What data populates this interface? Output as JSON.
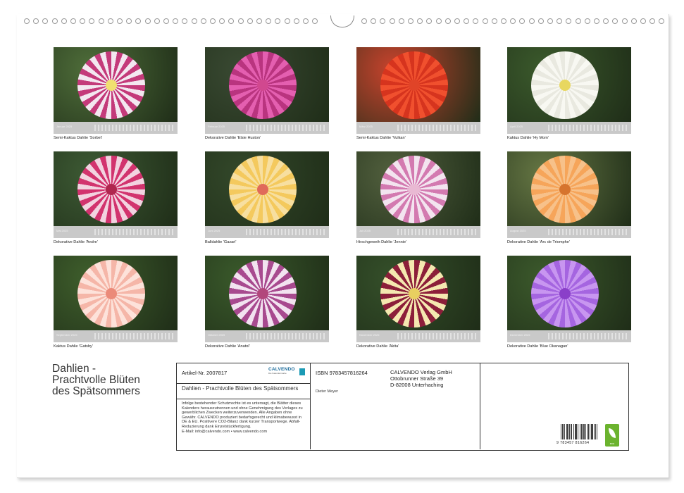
{
  "months": [
    {
      "caption": "Semi-Kaktus Dahlie 'Sorbet'",
      "month_label": "Januar 2025",
      "bg": "#4f6e3a",
      "petal": "#f3e7f0",
      "petal2": "#c43a7a",
      "core": "#f0e070"
    },
    {
      "caption": "Dekorative Dahlie 'Elsie Huston'",
      "month_label": "Februar 2025",
      "bg": "#3a4a33",
      "petal": "#e45fb0",
      "petal2": "#b9347f",
      "core": "#d1488f"
    },
    {
      "caption": "Semi-Kaktus Dahlie 'Vulkan'",
      "month_label": "März 2025",
      "bg": "#c9432d",
      "petal": "#f0502e",
      "petal2": "#d6341e",
      "core": "#e04428"
    },
    {
      "caption": "Kaktus Dahlie 'Hy Mom'",
      "month_label": "April 2025",
      "bg": "#3b5a2c",
      "petal": "#f8f8f2",
      "petal2": "#e9e9e0",
      "core": "#e8d760"
    },
    {
      "caption": "Dekorative Dahlie 'Andre'",
      "month_label": "Mai 2025",
      "bg": "#3d5a34",
      "petal": "#d2336e",
      "petal2": "#f2d3e0",
      "core": "#b0264f"
    },
    {
      "caption": "Balldahlie 'Gazari'",
      "month_label": "Juni 2025",
      "bg": "#33482a",
      "petal": "#f4c95d",
      "petal2": "#f7dfa0",
      "core": "#e06a5a"
    },
    {
      "caption": "Hirschgeweih Dahlie 'Jennie'",
      "month_label": "Juli 2025",
      "bg": "#52603e",
      "petal": "#f3e4ef",
      "petal2": "#d37ab0",
      "core": "#e9b9d3"
    },
    {
      "caption": "Dekorative Dahlie 'Arc de Triomphe'",
      "month_label": "August 2025",
      "bg": "#667744",
      "petal": "#f6a55a",
      "petal2": "#f7c18a",
      "core": "#d6742e"
    },
    {
      "caption": "Kaktus Dahlie 'Gatsby'",
      "month_label": "September 2025",
      "bg": "#3f5f2c",
      "petal": "#f5b6a8",
      "petal2": "#fde2da",
      "core": "#eb8a79"
    },
    {
      "caption": "Dekorative Dahlie 'Anatol'",
      "month_label": "Oktober 2025",
      "bg": "#3a5a2b",
      "petal": "#f2e3f0",
      "petal2": "#a84a8f",
      "core": "#b2477c"
    },
    {
      "caption": "Dekorative Dahlie 'Akita'",
      "month_label": "November 2025",
      "bg": "#35502a",
      "petal": "#8c1f3a",
      "petal2": "#f5e8b0",
      "core": "#e8cf60"
    },
    {
      "caption": "Dekorative Dahlie 'Blue Okanagan'",
      "month_label": "Dezember 2025",
      "bg": "#3c5a2c",
      "petal": "#a565e0",
      "petal2": "#c896f0",
      "core": "#8a3fc9"
    }
  ],
  "title": "Dahlien -\nPrachtvolle Blüten\ndes Spätsommers",
  "info": {
    "artnr": "Artikel-Nr. 2007817",
    "logo": "CALVENDO",
    "logo_sub": "Die Kalendermarke",
    "calendar_title": "Dahlien - Prachtvolle Blüten des Spätsommers",
    "legal": "Infolge bestehender Schutzrechte ist es untersagt, die Blätter dieses Kalenders herauszutrennen und ohne Genehmigung des Verlages zu gewerblichen Zwecken weiterzuverwenden. Alle Angaben ohne Gewähr. CALVENDO produziert bedarfsgerecht und klimabewusst in DE & EU. Positivere CO2-Bilanz dank kurzer Transportwege. Abfall-Reduzierung dank Einzelstückfertigung.\nE-Mail: info@calvendo.com • www.calvendo.com",
    "isbn": "ISBN 9783457816264",
    "publisher_line1": "CALVENDO Verlag GmbH",
    "publisher_line2": "Ottobrunner Straße 39",
    "publisher_line3": "D-82008 Unterhaching",
    "author": "Dieter Meyer",
    "barcode_number": "9 783457 816264",
    "eco_label": "eco"
  }
}
